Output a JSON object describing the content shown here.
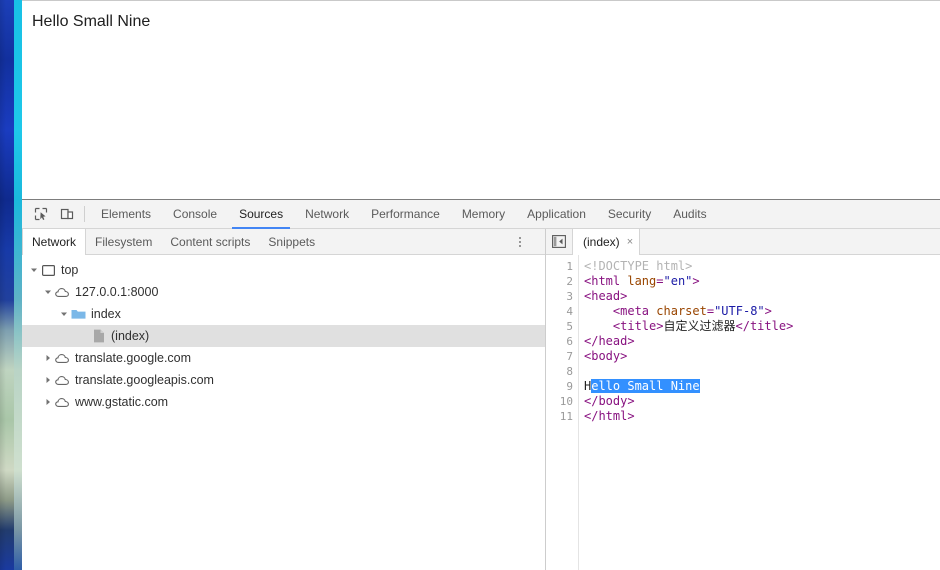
{
  "page": {
    "body_text": "Hello Small Nine"
  },
  "devtools": {
    "toolbar_icons": [
      {
        "name": "inspect-element-icon",
        "label": "Inspect element"
      },
      {
        "name": "device-toolbar-icon",
        "label": "Toggle device toolbar"
      }
    ],
    "tabs": [
      {
        "label": "Elements",
        "active": false
      },
      {
        "label": "Console",
        "active": false
      },
      {
        "label": "Sources",
        "active": true
      },
      {
        "label": "Network",
        "active": false
      },
      {
        "label": "Performance",
        "active": false
      },
      {
        "label": "Memory",
        "active": false
      },
      {
        "label": "Application",
        "active": false
      },
      {
        "label": "Security",
        "active": false
      },
      {
        "label": "Audits",
        "active": false
      }
    ],
    "accent_color": "#4285f4"
  },
  "navigator": {
    "tabs": [
      {
        "label": "Network",
        "active": true
      },
      {
        "label": "Filesystem",
        "active": false
      },
      {
        "label": "Content scripts",
        "active": false
      },
      {
        "label": "Snippets",
        "active": false
      }
    ],
    "more_options_label": "More options",
    "tree": [
      {
        "label": "top",
        "icon": "frame-icon",
        "twisty": "down",
        "indent": 0,
        "selected": false
      },
      {
        "label": "127.0.0.1:8000",
        "icon": "cloud-icon",
        "twisty": "down",
        "indent": 1,
        "selected": false
      },
      {
        "label": "index",
        "icon": "folder-icon",
        "twisty": "down",
        "indent": 2,
        "selected": false
      },
      {
        "label": "(index)",
        "icon": "document-icon",
        "twisty": "none",
        "indent": 3,
        "selected": true
      },
      {
        "label": "translate.google.com",
        "icon": "cloud-icon",
        "twisty": "right",
        "indent": 1,
        "selected": false
      },
      {
        "label": "translate.googleapis.com",
        "icon": "cloud-icon",
        "twisty": "right",
        "indent": 1,
        "selected": false
      },
      {
        "label": "www.gstatic.com",
        "icon": "cloud-icon",
        "twisty": "right",
        "indent": 1,
        "selected": false
      }
    ]
  },
  "editor": {
    "panel_toggle_label": "Show navigator",
    "tab_label": "(index)",
    "tab_close_label": "×",
    "line_numbers": [
      1,
      2,
      3,
      4,
      5,
      6,
      7,
      8,
      9,
      10,
      11
    ],
    "source_lines": [
      "<!DOCTYPE html>",
      "<html lang=\"en\">",
      "<head>",
      "    <meta charset=\"UTF-8\">",
      "    <title>自定义过滤器</title>",
      "</head>",
      "<body>",
      "",
      "Hello Small Nine",
      "</body>",
      "</html>"
    ],
    "selected_text": "ello Small Nine",
    "selection_color": "#3390ff",
    "doc_title": "自定义过滤器"
  }
}
